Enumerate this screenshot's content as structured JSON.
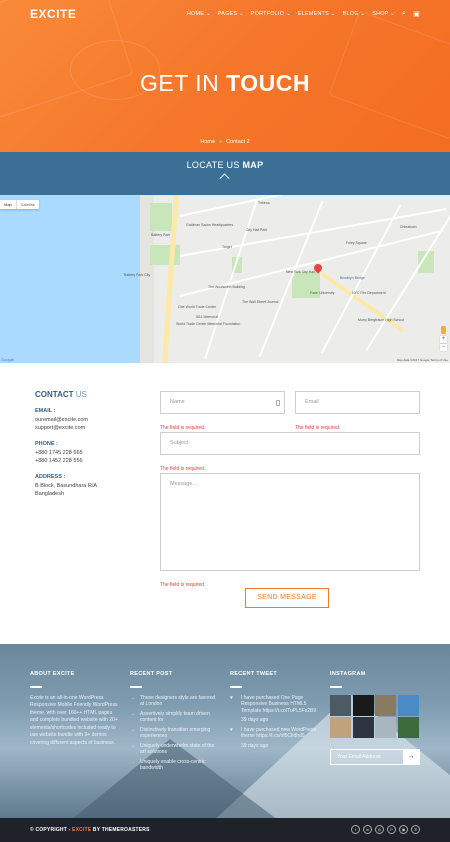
{
  "header": {
    "logo": "EXCITE",
    "nav": [
      "HOME ⌄",
      "PAGES ⌄",
      "PORTFOLIO ⌄",
      "ELEMENTS ⌄",
      "BLOG ⌄",
      "SHOP ⌄"
    ]
  },
  "hero": {
    "title_light": "GET IN",
    "title_bold": "TOUCH",
    "breadcrumb": [
      "Home",
      "Contact 2"
    ]
  },
  "locate": {
    "light": "LOCATE US",
    "bold": "MAP"
  },
  "map": {
    "tabs": [
      "Map",
      "Satellite"
    ],
    "labels": [
      "Battery Park",
      "Goldman Sachs Headquarters",
      "One World Trade Center",
      "The Wall Street Journal",
      "Target",
      "City Hall Park",
      "New York City Hall",
      "Brooklyn Bridge",
      "9/11 Memorial",
      "World Trade Center Memorial Foundation",
      "Battery Park City",
      "The Woolworth Building",
      "Pace University",
      "NYC Fire Department",
      "Foley Square",
      "Murry Bergtraum High School",
      "Tribeca",
      "Chinatown"
    ],
    "footer": "Map data ©2017 Google  Terms of Use",
    "google": "Google"
  },
  "contact": {
    "heading_bold": "CONTACT",
    "heading_light": "US",
    "email_label": "EMAIL :",
    "emails": [
      "ouremail@excite.com",
      "support@excite.com"
    ],
    "phone_label": "PHONE :",
    "phones": [
      "+880 1745 228 665",
      "+880 1452 228 556"
    ],
    "address_label": "ADDRESS :",
    "address": [
      "B Block, Basundhara R/A",
      "Bangladesh"
    ]
  },
  "form": {
    "name_placeholder": "Name",
    "email_placeholder": "Email",
    "subject_placeholder": "Subject",
    "message_placeholder": "Message...",
    "error": "The field is required.",
    "send": "SEND MESSAGE"
  },
  "footer": {
    "about_title": "ABOUT EXCITE",
    "about_text": "Excite is an all-in-one WordPress Responsive Mobile Friendly WordPress theme, with over 160++ HTML pages and complete bundled website with 20+ elements/shortcodes included ready to use website bundle with 9+ demos covering different aspects of business.",
    "recent_title": "RECENT POST",
    "posts": [
      "These designers style are favored at London",
      "Assertively simplify team driven content for",
      "Distinctively transition emerging experiences",
      "Uniquely underwhelm state of the art solutions",
      "Uniquely enable cross-centric bandwidth"
    ],
    "tweet_title": "RECENT TWEET",
    "tweets": [
      {
        "text": "I have purchased One Page Responsive Business HTML5 Template https://t.co/TuPL5Fs2B9",
        "when": "39 days ago"
      },
      {
        "text": "I have purchased new WordPress theme https://t.co/xf5ClIdhd5",
        "when": "39 days ago"
      }
    ],
    "insta_title": "INSTAGRAM",
    "insta_colors": [
      "#4d5a66",
      "#1a1a1a",
      "#8a7a62",
      "#4b8cc8",
      "#c0a37a",
      "#2b3440",
      "#a8b6c1",
      "#3c6a3a"
    ],
    "email_placeholder": "Your Email Address",
    "email_go": "→"
  },
  "bottom": {
    "copy_a": "© COPYRIGHT - ",
    "copy_b": "EXCITE",
    "copy_c": " BY THEMEROASTERS",
    "socials": [
      "f",
      "in",
      "◎",
      "P",
      "◉",
      "ℬ"
    ]
  },
  "colors": {
    "accent": "#f5772a",
    "blue": "#3b6f95",
    "error": "#e23c3c",
    "footer_dark": "#1f2229"
  }
}
